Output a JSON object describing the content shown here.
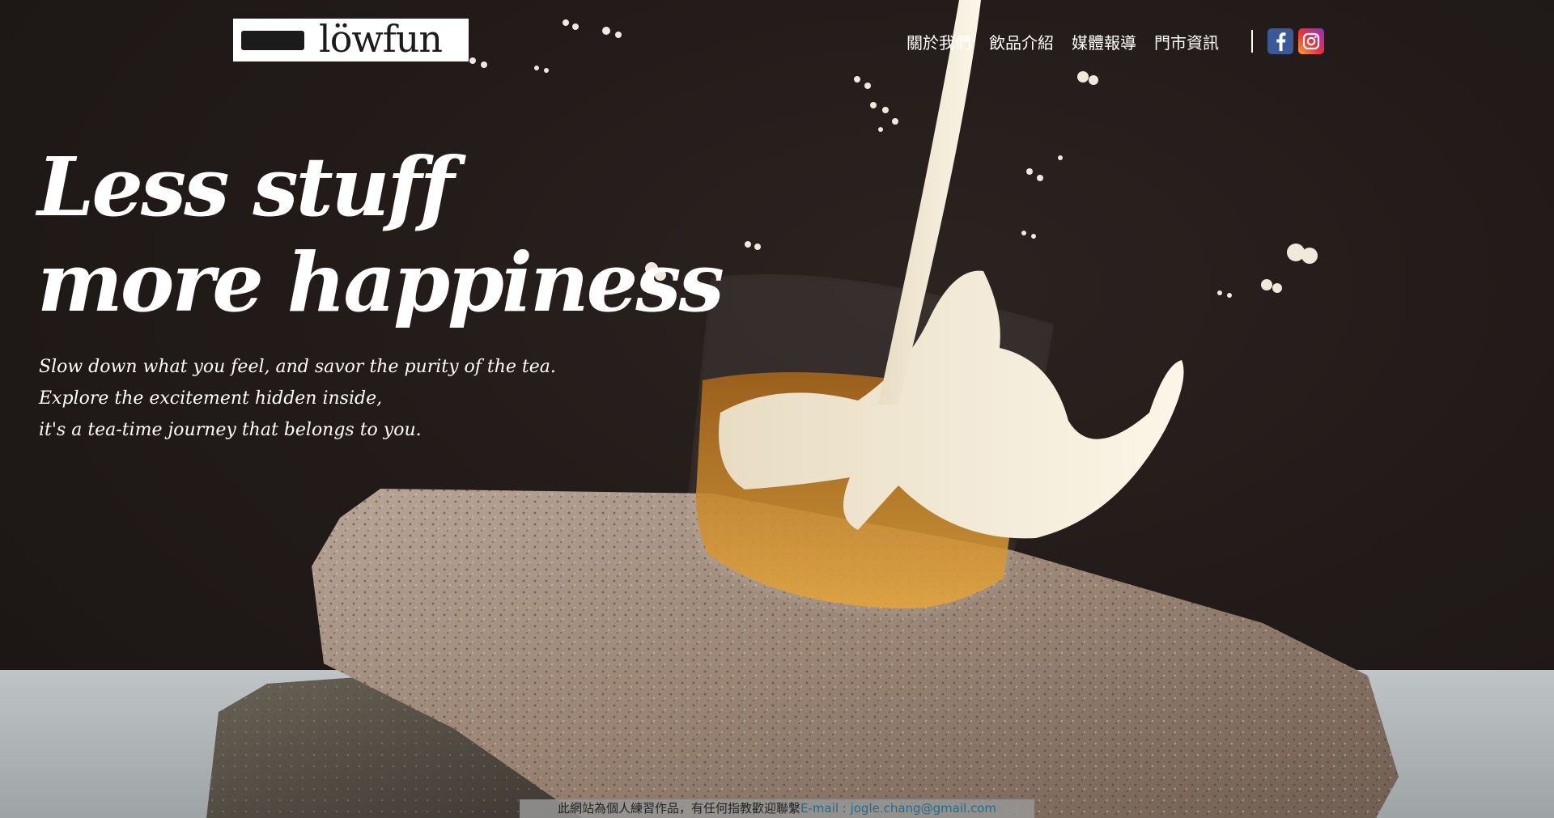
{
  "brand": {
    "logo_text": "löwfun"
  },
  "nav": {
    "items": [
      {
        "label": "關於我們"
      },
      {
        "label": "飲品介紹"
      },
      {
        "label": "媒體報導"
      },
      {
        "label": "門市資訊"
      }
    ],
    "social": [
      {
        "icon": "facebook-icon",
        "color": "#3b5998"
      },
      {
        "icon": "instagram-icon",
        "color": "#e1306c"
      }
    ]
  },
  "hero": {
    "headline_line1": "Less stuff",
    "headline_line2": "more happiness",
    "sub_line1": "Slow down what you feel, and savor the purity of the tea.",
    "sub_line2": "Explore the excitement hidden inside,",
    "sub_line3": "it's a tea-time journey that belongs to you.",
    "image": "milk-pouring-into-tea-glass-on-granite-stones"
  },
  "footer_notice": {
    "text": "此網站為個人練習作品，有任何指教歡迎聯繫",
    "email": "E-mail : jogle.chang@gmail.com",
    "email_color": "#1d6f8a"
  },
  "colors": {
    "background": "#1f1917",
    "text": "#ffffff",
    "stone": "#a79383",
    "tea": "#c98a2b"
  }
}
